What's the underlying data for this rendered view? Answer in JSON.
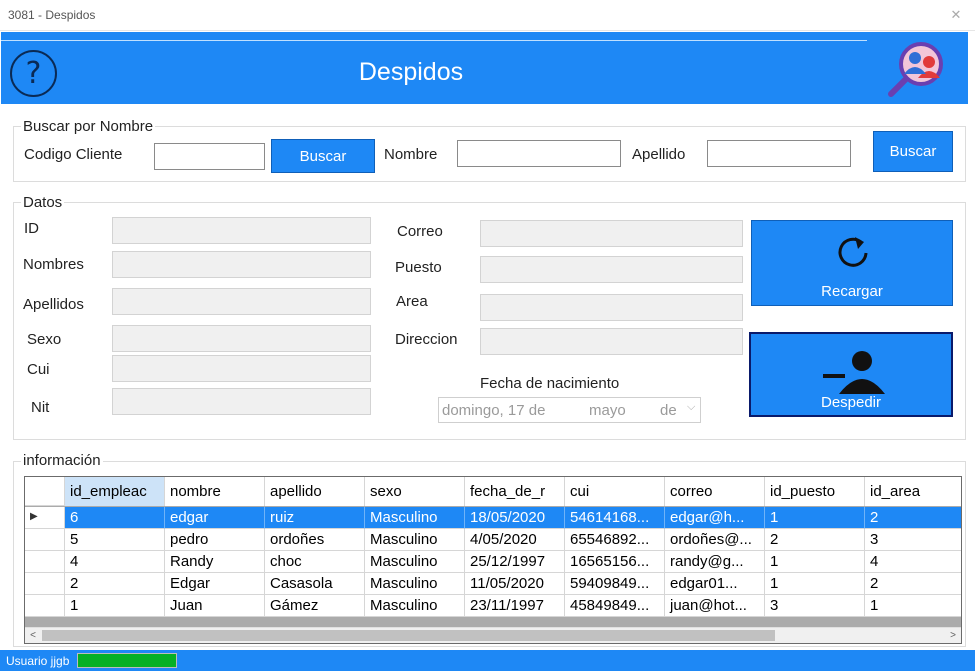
{
  "window": {
    "title": "3081 - Despidos",
    "close_label": "✕"
  },
  "header": {
    "help_symbol": "?",
    "title": "Despidos"
  },
  "search": {
    "legend": "Buscar por Nombre",
    "codigo_label": "Codigo Cliente",
    "codigo_value": "",
    "buscar1_label": "Buscar",
    "nombre_label": "Nombre",
    "nombre_value": "",
    "apellido_label": "Apellido",
    "apellido_value": "",
    "buscar2_label": "Buscar"
  },
  "datos": {
    "legend": "Datos",
    "id_label": "ID",
    "nombres_label": "Nombres",
    "apellidos_label": "Apellidos",
    "sexo_label": "Sexo",
    "cui_label": "Cui",
    "nit_label": "Nit",
    "correo_label": "Correo",
    "puesto_label": "Puesto",
    "area_label": "Area",
    "direccion_label": "Direccion",
    "fecha_label": "Fecha de nacimiento",
    "fecha_day": "domingo, 17 de",
    "fecha_month": "mayo",
    "fecha_de": "de",
    "recargar_label": "Recargar",
    "despedir_label": "Despedir"
  },
  "info": {
    "legend": "información",
    "columns": [
      "id_empleac",
      "nombre",
      "apellido",
      "sexo",
      "fecha_de_r",
      "cui",
      "correo",
      "id_puesto",
      "id_area"
    ],
    "rows": [
      [
        "6",
        "edgar",
        "ruiz",
        "Masculino",
        "18/05/2020",
        "54614168...",
        "edgar@h...",
        "1",
        "2"
      ],
      [
        "5",
        "pedro",
        "ordoñes",
        "Masculino",
        "4/05/2020",
        "65546892...",
        "ordoñes@...",
        "2",
        "3"
      ],
      [
        "4",
        "Randy",
        "choc",
        "Masculino",
        "25/12/1997",
        "16565156...",
        "randy@g...",
        "1",
        "4"
      ],
      [
        "2",
        "Edgar",
        "Casasola",
        "Masculino",
        "11/05/2020",
        "59409849...",
        "edgar01...",
        "1",
        "2"
      ],
      [
        "1",
        "Juan",
        "Gámez",
        "Masculino",
        "23/11/1997",
        "45849849...",
        "juan@hot...",
        "3",
        "1"
      ]
    ],
    "selected_row": 0,
    "scroll_left": "<",
    "scroll_right": ">"
  },
  "status": {
    "user_text": "Usuario  jjgb",
    "progress": 1.0,
    "progress_color": "#06b025"
  },
  "colors": {
    "accent": "#1e88f5",
    "help_ring": "#0a2a55"
  }
}
